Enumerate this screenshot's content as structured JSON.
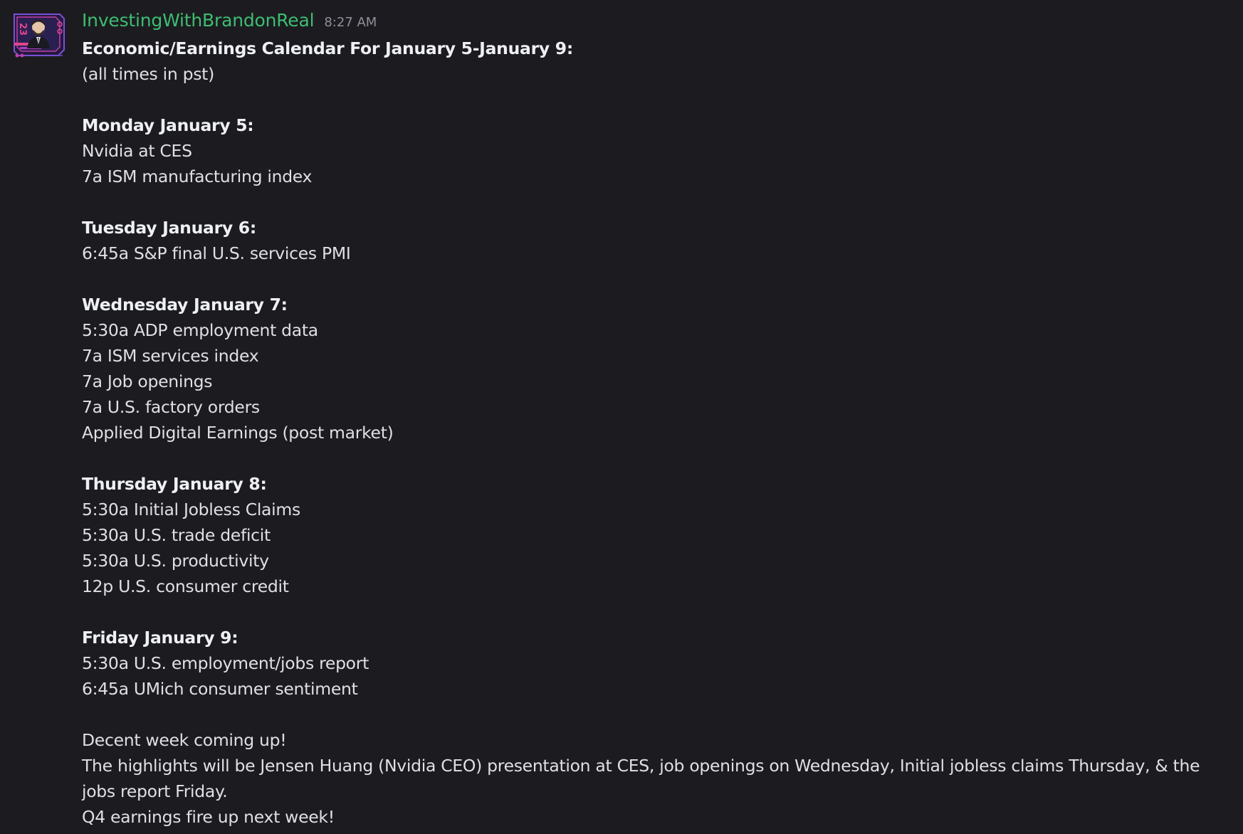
{
  "header": {
    "username": "InvestingWithBrandonReal",
    "timestamp": "8:27 AM"
  },
  "message": {
    "title": "Economic/Earnings Calendar For January 5-January 9:",
    "note": "(all times in pst)",
    "days": [
      {
        "heading": "Monday January 5:",
        "items": [
          "Nvidia at CES",
          "7a ISM manufacturing index"
        ]
      },
      {
        "heading": "Tuesday January 6:",
        "items": [
          "6:45a S&P final U.S. services PMI"
        ]
      },
      {
        "heading": "Wednesday January 7:",
        "items": [
          "5:30a ADP employment data",
          "7a ISM services index",
          "7a Job openings",
          "7a U.S. factory orders",
          "Applied Digital Earnings (post market)"
        ]
      },
      {
        "heading": "Thursday January 8:",
        "items": [
          "5:30a Initial Jobless Claims",
          "5:30a U.S. trade deficit",
          "5:30a U.S. productivity",
          "12p U.S. consumer credit"
        ]
      },
      {
        "heading": "Friday January 9:",
        "items": [
          "5:30a U.S. employment/jobs report",
          "6:45a UMich consumer sentiment"
        ]
      }
    ],
    "closing": [
      "Decent week coming up!",
      "The highlights will be Jensen Huang (Nvidia CEO) presentation at CES, job openings on Wednesday, Initial jobless claims Thursday, & the jobs report Friday.",
      "Q4 earnings fire up next week!"
    ]
  },
  "avatar": {
    "icon": "user-avatar-icon",
    "badge_text": "23"
  },
  "colors": {
    "background": "#1c1c20",
    "username": "#3dbd72",
    "text": "#dfe0e3",
    "timestamp": "#8e9099",
    "avatar_accent": "#d6338f"
  }
}
